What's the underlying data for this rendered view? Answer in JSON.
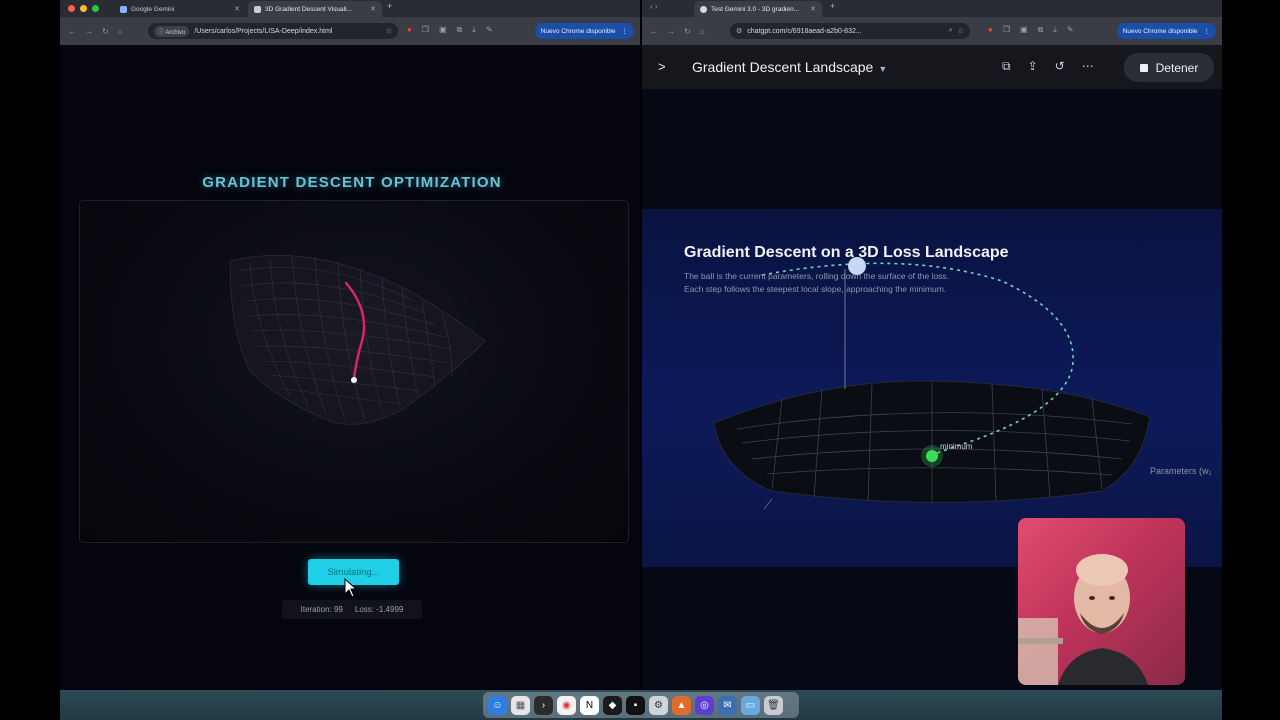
{
  "left_browser": {
    "tabs": [
      {
        "label": "Google Gemini"
      },
      {
        "label": "3D Gradient Descent Visuali..."
      }
    ],
    "new_tab": "+",
    "address_chip": "Archivo",
    "url": "/Users/carlos/Projects/LISA-Deep/index.html",
    "update_label": "Nuevo Chrome disponible"
  },
  "right_browser": {
    "tabs": [
      {
        "label": "Test Gemini 3.0 - 3D gradien..."
      }
    ],
    "new_tab": "+",
    "url": "chatgpt.com/c/6918aead-a2b0-832...",
    "update_label": "Nuevo Chrome disponible"
  },
  "left_page": {
    "title": "GRADIENT DESCENT OPTIMIZATION",
    "button_label": "Simulating...",
    "iteration": "Iteration: 99",
    "loss": "Loss: -1.4999"
  },
  "right_page": {
    "conversation_title": "Gradient Descent Landscape",
    "stop_label": "Detener",
    "viz_title": "Gradient Descent on a 3D Loss Landscape",
    "viz_subtitle_1": "The ball is the current parameters, rolling down the surface of the loss.",
    "viz_subtitle_2": "Each step follows the steepest local slope, approaching the minimum.",
    "minimum_label": "minimum",
    "axis_label": "Parameters (w₁"
  },
  "icons": {
    "chevron": "chevron-right-icon",
    "stop": "stop-square-icon"
  },
  "colors": {
    "accent_cyan": "#1ecfe6",
    "path_red": "#e0245e",
    "minimum_green": "#3ddc57",
    "update_blue": "#1a4ea8"
  }
}
